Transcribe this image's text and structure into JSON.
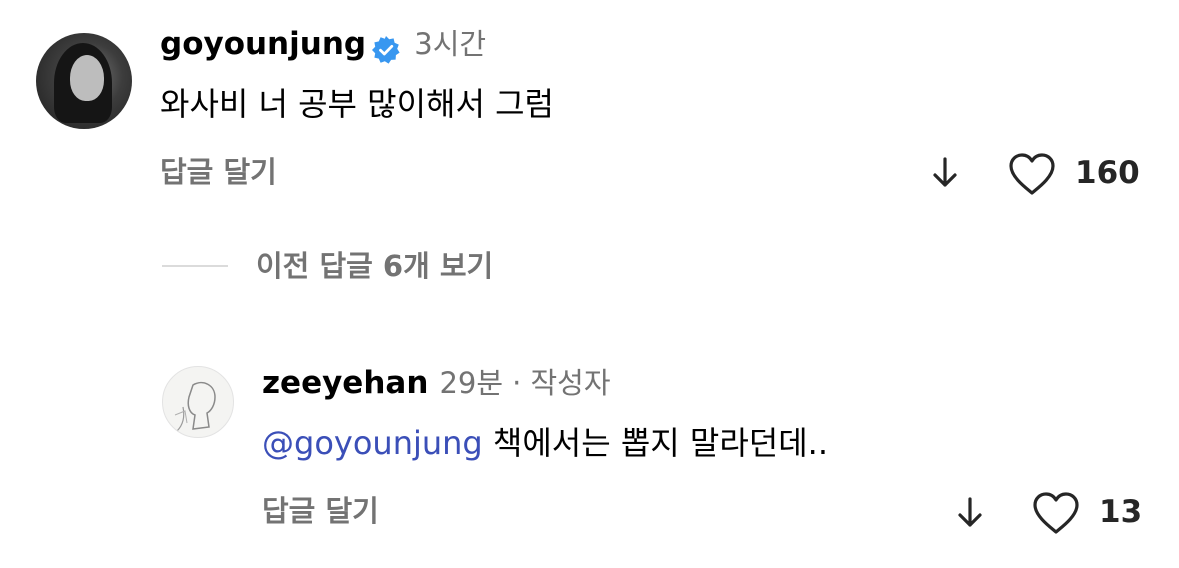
{
  "comments": [
    {
      "username": "goyounjung",
      "verified": true,
      "time": "3시간",
      "text": "와사비 너 공부 많이해서 그럼",
      "reply_label": "답글 달기",
      "likes": "160"
    },
    {
      "username": "zeeyehan",
      "time": "29분",
      "separator": "·",
      "author_badge": "작성자",
      "mention": "@goyounjung",
      "text": "책에서는 뽑지 말라던데..",
      "reply_label": "답글 달기",
      "likes": "13"
    }
  ],
  "thread": {
    "view_previous_label": "이전 답글 6개 보기"
  },
  "icons": {
    "verified": "verified-badge-icon",
    "dislike": "arrow-down-icon",
    "like": "heart-outline-icon"
  },
  "colors": {
    "verified_blue": "#3897f0",
    "mention": "#3b4fb8",
    "secondary_text": "#737373"
  }
}
